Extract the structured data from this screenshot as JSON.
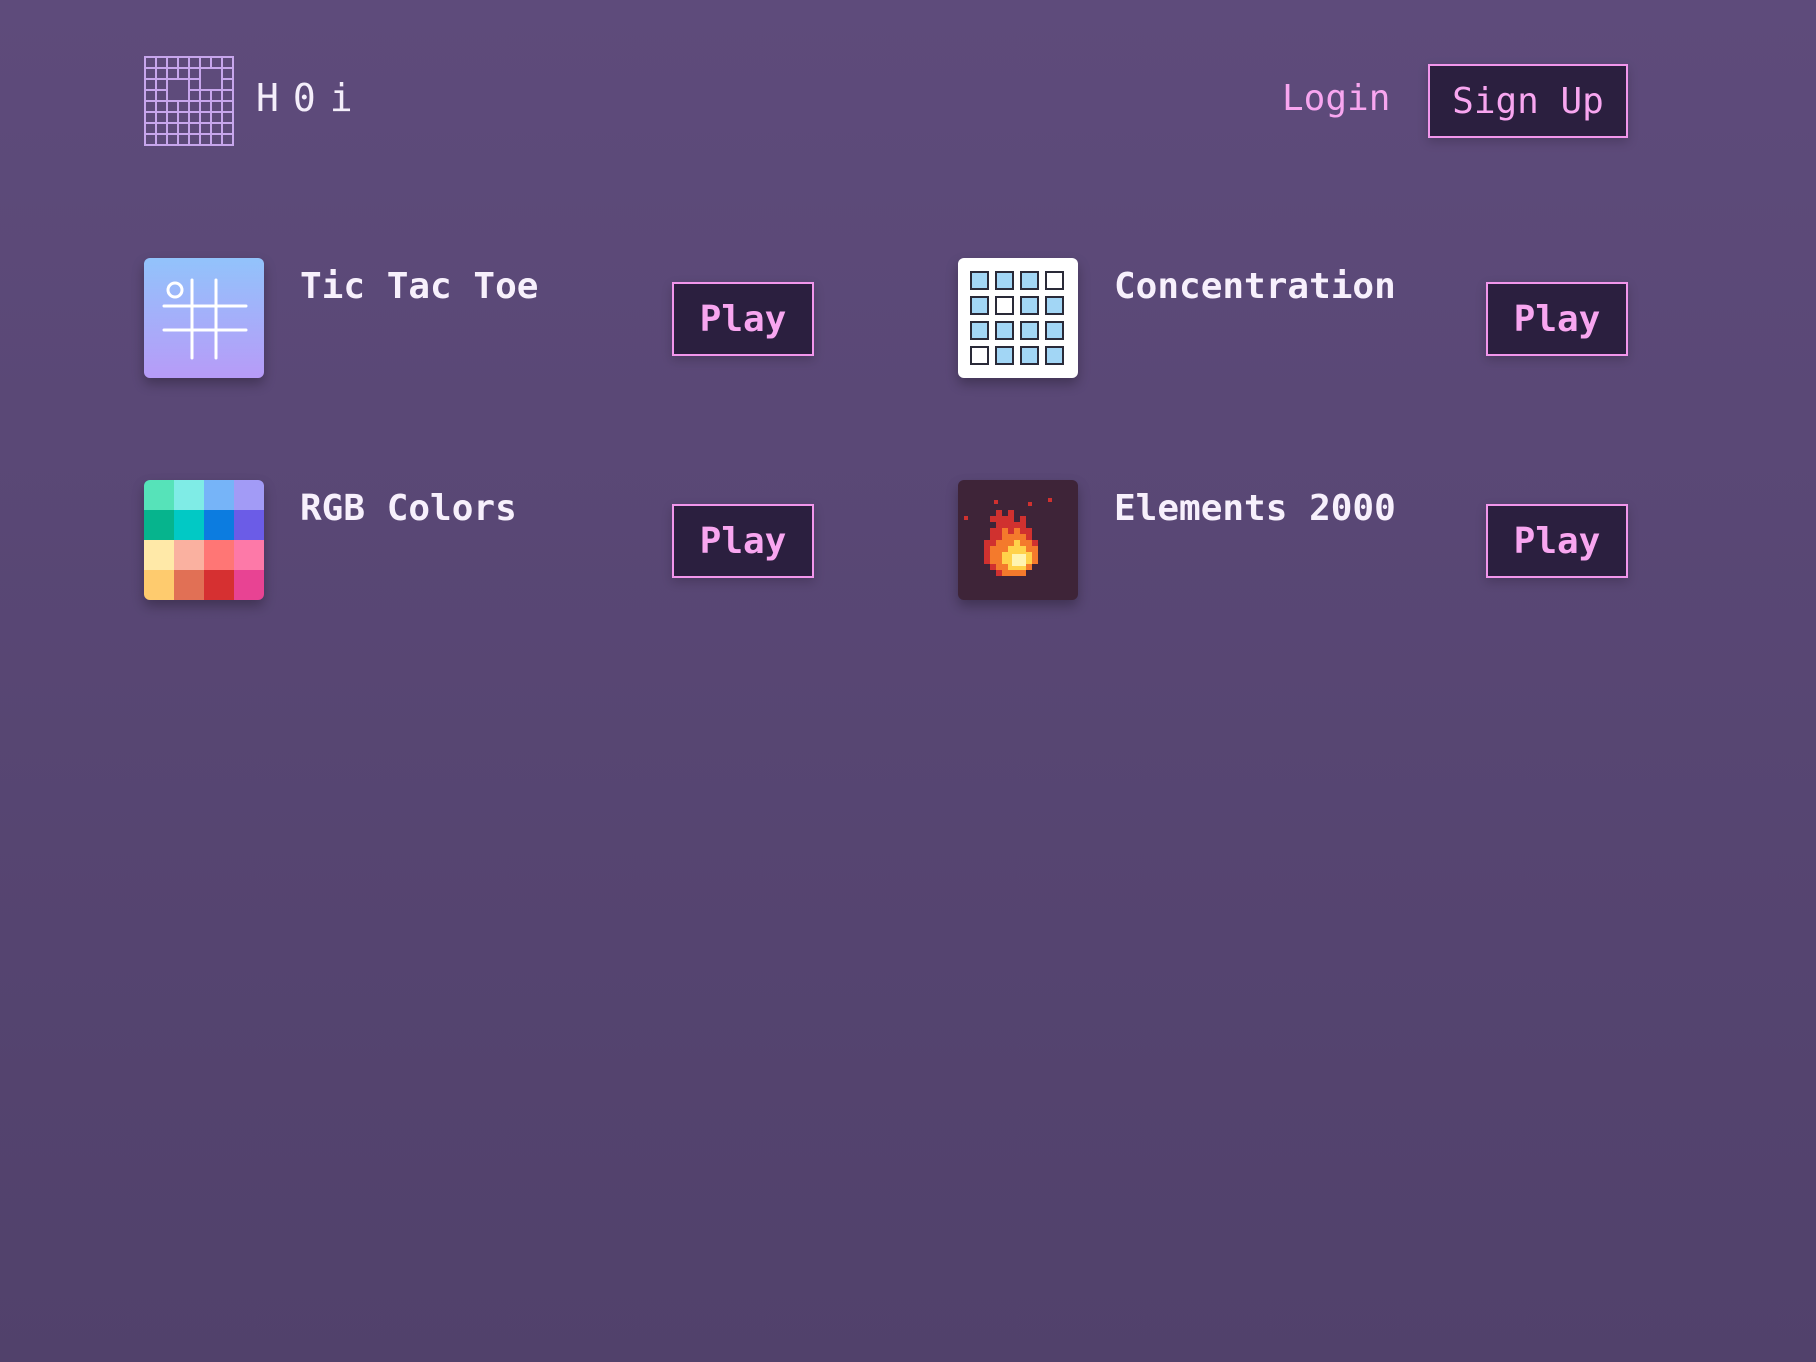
{
  "header": {
    "brand": "H0i",
    "login_label": "Login",
    "signup_label": "Sign Up"
  },
  "games": [
    {
      "name": "Tic Tac Toe",
      "play_label": "Play",
      "icon": "tic-tac-toe-icon"
    },
    {
      "name": "Concentration",
      "play_label": "Play",
      "icon": "memory-grid-icon"
    },
    {
      "name": "RGB Colors",
      "play_label": "Play",
      "icon": "color-palette-icon"
    },
    {
      "name": "Elements 2000",
      "play_label": "Play",
      "icon": "fire-icon"
    }
  ],
  "colors": {
    "background_top": "#5e4b7b",
    "background_bottom": "#51416b",
    "accent_pink": "#f8a6f0",
    "button_bg": "#2b1f3f"
  }
}
